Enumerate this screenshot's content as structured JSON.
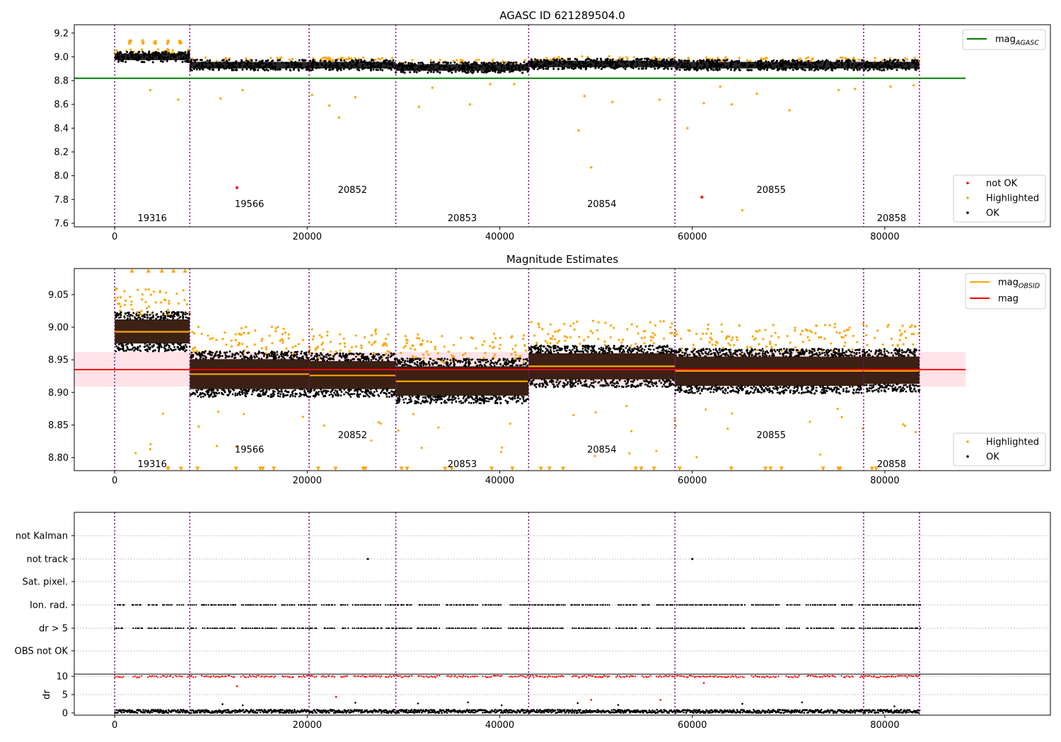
{
  "figure": {
    "title_top": "AGASC ID 621289504.0",
    "title_middle": "Magnitude Estimates"
  },
  "chart_data": [
    {
      "type": "scatter",
      "title": "AGASC ID 621289504.0",
      "xlabel": "",
      "ylabel": "",
      "xlim": [
        -4200,
        97200
      ],
      "ylim": [
        7.57,
        9.27
      ],
      "xticks": [
        0,
        20000,
        40000,
        60000,
        80000
      ],
      "yticks": [
        7.6,
        7.8,
        8.0,
        8.2,
        8.4,
        8.6,
        8.8,
        9.0,
        9.2
      ],
      "obsid_boundaries": [
        0,
        7800,
        20200,
        29200,
        43000,
        58200,
        77800,
        83600
      ],
      "obsid_labels": [
        {
          "text": "19316",
          "x": 3900,
          "y": 7.64
        },
        {
          "text": "19566",
          "x": 14000,
          "y": 7.76
        },
        {
          "text": "20852",
          "x": 24700,
          "y": 7.88
        },
        {
          "text": "20853",
          "x": 36100,
          "y": 7.64
        },
        {
          "text": "20854",
          "x": 50600,
          "y": 7.76
        },
        {
          "text": "20855",
          "x": 68200,
          "y": 7.88
        },
        {
          "text": "20858",
          "x": 80700,
          "y": 7.64
        }
      ],
      "mag_agasc": 8.82,
      "obs_segments": [
        {
          "x0": 0,
          "x1": 7800,
          "level": 9.0
        },
        {
          "x0": 7800,
          "x1": 20200,
          "level": 8.93
        },
        {
          "x0": 20200,
          "x1": 29200,
          "level": 8.93
        },
        {
          "x0": 29200,
          "x1": 43000,
          "level": 8.91
        },
        {
          "x0": 43000,
          "x1": 58200,
          "level": 8.94
        },
        {
          "x0": 58200,
          "x1": 77800,
          "level": 8.93
        },
        {
          "x0": 77800,
          "x1": 83600,
          "level": 8.93
        }
      ],
      "not_ok_points": [
        [
          12700,
          7.9
        ],
        [
          61000,
          7.82
        ]
      ],
      "highlighted_outliers": [
        [
          3700,
          8.72
        ],
        [
          6600,
          8.64
        ],
        [
          11000,
          8.65
        ],
        [
          13300,
          8.72
        ],
        [
          20500,
          8.68
        ],
        [
          22300,
          8.59
        ],
        [
          23300,
          8.49
        ],
        [
          25000,
          8.66
        ],
        [
          31600,
          8.58
        ],
        [
          33000,
          8.74
        ],
        [
          36900,
          8.6
        ],
        [
          39000,
          8.77
        ],
        [
          41500,
          8.77
        ],
        [
          48200,
          8.38
        ],
        [
          49500,
          8.07
        ],
        [
          48800,
          8.67
        ],
        [
          51700,
          8.62
        ],
        [
          56600,
          8.64
        ],
        [
          59500,
          8.4
        ],
        [
          61200,
          8.61
        ],
        [
          62900,
          8.75
        ],
        [
          64100,
          8.6
        ],
        [
          65200,
          7.71
        ],
        [
          66700,
          8.69
        ],
        [
          70100,
          8.55
        ],
        [
          75200,
          8.72
        ],
        [
          76900,
          8.73
        ],
        [
          80600,
          8.75
        ],
        [
          83000,
          8.76
        ]
      ],
      "legend": [
        {
          "label": "mag",
          "subscript": "AGASC",
          "kind": "line",
          "color": "#008000"
        },
        {
          "label": "not OK",
          "kind": "point",
          "color": "#ff0000"
        },
        {
          "label": "Highlighted",
          "kind": "point",
          "color": "#ffa500"
        },
        {
          "label": "OK",
          "kind": "point",
          "color": "#000000"
        }
      ]
    },
    {
      "type": "scatter",
      "title": "Magnitude Estimates",
      "xlabel": "",
      "ylabel": "",
      "xlim": [
        -4200,
        97200
      ],
      "ylim": [
        8.78,
        9.09
      ],
      "xticks": [
        0,
        20000,
        40000,
        60000,
        80000
      ],
      "yticks": [
        8.8,
        8.85,
        8.9,
        8.95,
        9.0,
        9.05
      ],
      "obsid_labels": [
        {
          "text": "19316",
          "x": 3900,
          "y": 8.79
        },
        {
          "text": "19566",
          "x": 14000,
          "y": 8.812
        },
        {
          "text": "20852",
          "x": 24700,
          "y": 8.834
        },
        {
          "text": "20853",
          "x": 36100,
          "y": 8.79
        },
        {
          "text": "20854",
          "x": 50600,
          "y": 8.812
        },
        {
          "text": "20855",
          "x": 68200,
          "y": 8.834
        },
        {
          "text": "20858",
          "x": 80700,
          "y": 8.79
        }
      ],
      "mag_overall": 8.935,
      "mag_band": [
        8.909,
        8.962
      ],
      "obsid_mag": [
        {
          "x0": 0,
          "x1": 7800,
          "mag": 8.993,
          "lo": 8.975,
          "hi": 9.012
        },
        {
          "x0": 7800,
          "x1": 20200,
          "mag": 8.928,
          "lo": 8.905,
          "hi": 8.951
        },
        {
          "x0": 20200,
          "x1": 29200,
          "mag": 8.926,
          "lo": 8.905,
          "hi": 8.948
        },
        {
          "x0": 29200,
          "x1": 43000,
          "mag": 8.917,
          "lo": 8.895,
          "hi": 8.94
        },
        {
          "x0": 43000,
          "x1": 58200,
          "mag": 8.94,
          "lo": 8.92,
          "hi": 8.96
        },
        {
          "x0": 58200,
          "x1": 77800,
          "mag": 8.933,
          "lo": 8.91,
          "hi": 8.955
        },
        {
          "x0": 77800,
          "x1": 83600,
          "mag": 8.933,
          "lo": 8.913,
          "hi": 8.955
        }
      ],
      "legend": [
        {
          "label": "mag",
          "subscript": "OBSID",
          "kind": "line",
          "color": "#ffa500"
        },
        {
          "label": "mag",
          "kind": "line",
          "color": "#ff0000"
        },
        {
          "label": "Highlighted",
          "kind": "point",
          "color": "#ffa500"
        },
        {
          "label": "OK",
          "kind": "point",
          "color": "#000000"
        }
      ]
    },
    {
      "type": "scatter",
      "title": "",
      "xlabel": "",
      "ylabel": "",
      "xlim": [
        -4200,
        97200
      ],
      "categories": [
        "not Kalman",
        "not track",
        "Sat. pixel.",
        "Ion. rad.",
        "dr > 5",
        "OBS not OK"
      ],
      "not_track_points": [
        26300,
        60000
      ],
      "flag_gaps": [
        [
          1000,
          1800
        ],
        [
          2900,
          3400
        ],
        [
          4500,
          4800
        ],
        [
          6100,
          6300
        ],
        [
          7200,
          7500
        ],
        [
          8500,
          9000
        ],
        [
          12600,
          13100
        ],
        [
          16800,
          17300
        ],
        [
          18700,
          19000
        ],
        [
          21100,
          21500
        ],
        [
          22900,
          23400
        ],
        [
          24300,
          24700
        ],
        [
          27800,
          28100
        ],
        [
          30900,
          31400
        ],
        [
          33800,
          34400
        ],
        [
          37700,
          38200
        ],
        [
          40300,
          40900
        ],
        [
          46800,
          47400
        ],
        [
          51500,
          52100
        ],
        [
          54200,
          54700
        ],
        [
          55700,
          56200
        ],
        [
          65500,
          66100
        ],
        [
          69100,
          69700
        ],
        [
          71300,
          71800
        ],
        [
          74900,
          75400
        ],
        [
          76800,
          77300
        ]
      ]
    },
    {
      "type": "scatter",
      "title": "",
      "xlabel": "",
      "ylabel": "dr",
      "xlim": [
        -4200,
        97200
      ],
      "ylim": [
        -0.6,
        10.6
      ],
      "yticks": [
        0,
        5,
        10
      ],
      "red_points": [
        [
          12700,
          7.3
        ],
        [
          23000,
          4.4
        ],
        [
          49500,
          3.6
        ],
        [
          56700,
          3.6
        ],
        [
          61200,
          8.2
        ]
      ],
      "black_outliers": [
        [
          11200,
          2.4
        ],
        [
          13300,
          2.1
        ],
        [
          25000,
          2.8
        ],
        [
          31500,
          2.6
        ],
        [
          36700,
          2.9
        ],
        [
          40200,
          2.1
        ],
        [
          48100,
          2.7
        ],
        [
          52300,
          2.2
        ],
        [
          65200,
          2.5
        ],
        [
          71400,
          2.9
        ],
        [
          81000,
          1.8
        ]
      ]
    }
  ],
  "colors": {
    "highlighted": "#ffa500",
    "ok": "#000000",
    "not_ok": "#ff0000",
    "agasc_line": "#008000",
    "boundary": "#800080",
    "band": "#ffc0cb"
  }
}
